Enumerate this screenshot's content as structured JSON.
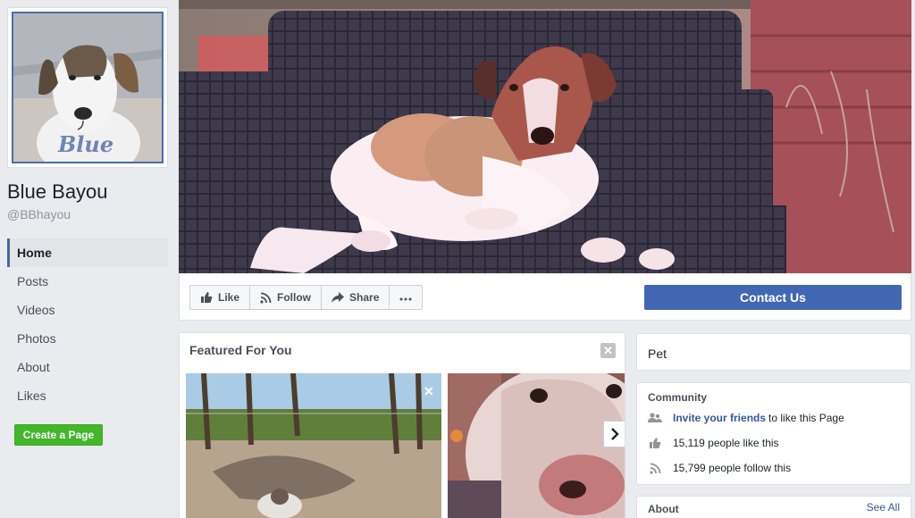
{
  "profile": {
    "name": "Blue Bayou",
    "handle": "@BBhayou",
    "signature": "Blue"
  },
  "nav": [
    {
      "label": "Home",
      "active": true
    },
    {
      "label": "Posts"
    },
    {
      "label": "Videos"
    },
    {
      "label": "Photos"
    },
    {
      "label": "About"
    },
    {
      "label": "Likes"
    }
  ],
  "create_page_label": "Create a Page",
  "actions": {
    "like": "Like",
    "follow": "Follow",
    "share": "Share",
    "contact": "Contact Us"
  },
  "featured": {
    "title": "Featured For You"
  },
  "category": "Pet",
  "community": {
    "title": "Community",
    "invite_link": "Invite your friends",
    "invite_rest": "to like this Page",
    "likes_text": "15,119 people like this",
    "follows_text": "15,799 people follow this"
  },
  "about": {
    "title": "About",
    "see_all": "See All"
  },
  "colors": {
    "brand_blue": "#4267b2",
    "create_green": "#42b72a",
    "link_blue": "#365899"
  },
  "icons": [
    "thumbs-up-icon",
    "rss-icon",
    "share-arrow-icon",
    "more-dots-icon",
    "close-icon",
    "chevron-right-icon",
    "people-icon"
  ]
}
